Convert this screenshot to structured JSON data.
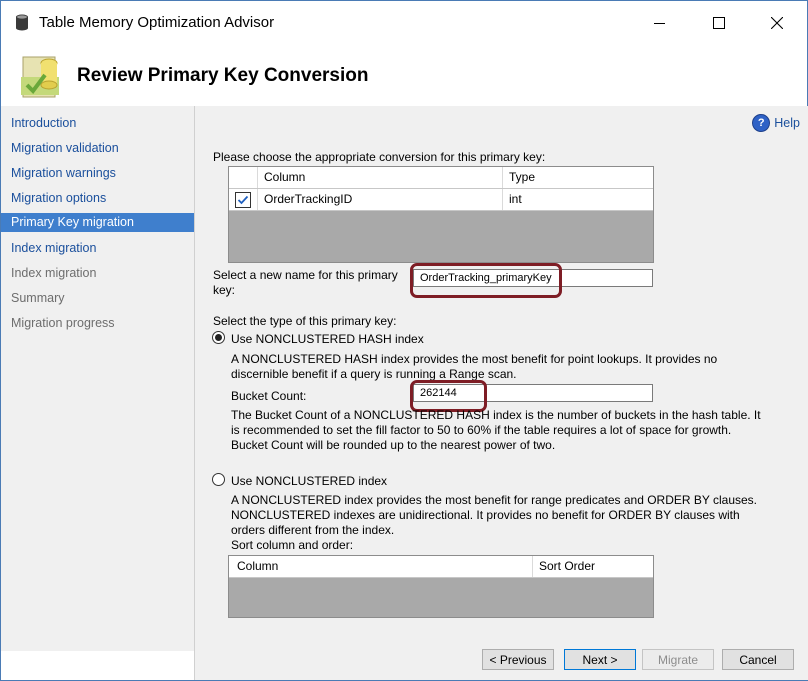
{
  "window": {
    "title": "Table Memory Optimization Advisor",
    "header": "Review Primary Key Conversion",
    "accent_color": "#3f7fcd",
    "highlight_color": "#7e1d25"
  },
  "sidebar": {
    "items": [
      {
        "label": "Introduction",
        "state": "link"
      },
      {
        "label": "Migration validation",
        "state": "link"
      },
      {
        "label": "Migration warnings",
        "state": "link"
      },
      {
        "label": "Migration options",
        "state": "link"
      },
      {
        "label": "Primary Key migration",
        "state": "selected"
      },
      {
        "label": "Index migration",
        "state": "link"
      },
      {
        "label": "Index migration",
        "state": "disabled"
      },
      {
        "label": "Summary",
        "state": "disabled"
      },
      {
        "label": "Migration progress",
        "state": "disabled"
      }
    ]
  },
  "help": {
    "label": "Help"
  },
  "pk": {
    "prompt": "Please choose the appropriate conversion for this primary key:",
    "columns": [
      "Column",
      "Type"
    ],
    "rows": [
      {
        "checked": true,
        "column": "OrderTrackingID",
        "type": "int"
      }
    ],
    "name_label_line1": "Select a new name for this primary",
    "name_label_line2": "key:",
    "name_value": "OrderTracking_primaryKey",
    "type_label": "Select the type of this primary key:"
  },
  "hash": {
    "option_label": "Use NONCLUSTERED HASH index",
    "desc_line1": "A NONCLUSTERED HASH index provides the most benefit for point lookups. It provides no",
    "desc_line2": "discernible benefit if a query is running a Range scan.",
    "bucket_label": "Bucket Count:",
    "bucket_value": "262144",
    "bucket_desc_line1": "The Bucket Count of a NONCLUSTERED HASH index is the number of buckets in the hash table. It",
    "bucket_desc_line2": "is recommended to set the fill factor to 50 to 60% if the table requires a lot of space for growth.",
    "bucket_desc_line3": "Bucket Count will be rounded up to the nearest power of two."
  },
  "nonclustered": {
    "option_label": "Use NONCLUSTERED index",
    "desc_line1": "A NONCLUSTERED index provides the most benefit for range predicates and ORDER BY clauses.",
    "desc_line2": "NONCLUSTERED indexes are unidirectional. It provides no benefit for ORDER BY clauses with",
    "desc_line3": "orders different from the index.",
    "sort_label": "Sort column and order:",
    "columns": [
      "Column",
      "Sort Order"
    ]
  },
  "footer": {
    "previous": "< Previous",
    "next": "Next >",
    "migrate": "Migrate",
    "cancel": "Cancel"
  }
}
